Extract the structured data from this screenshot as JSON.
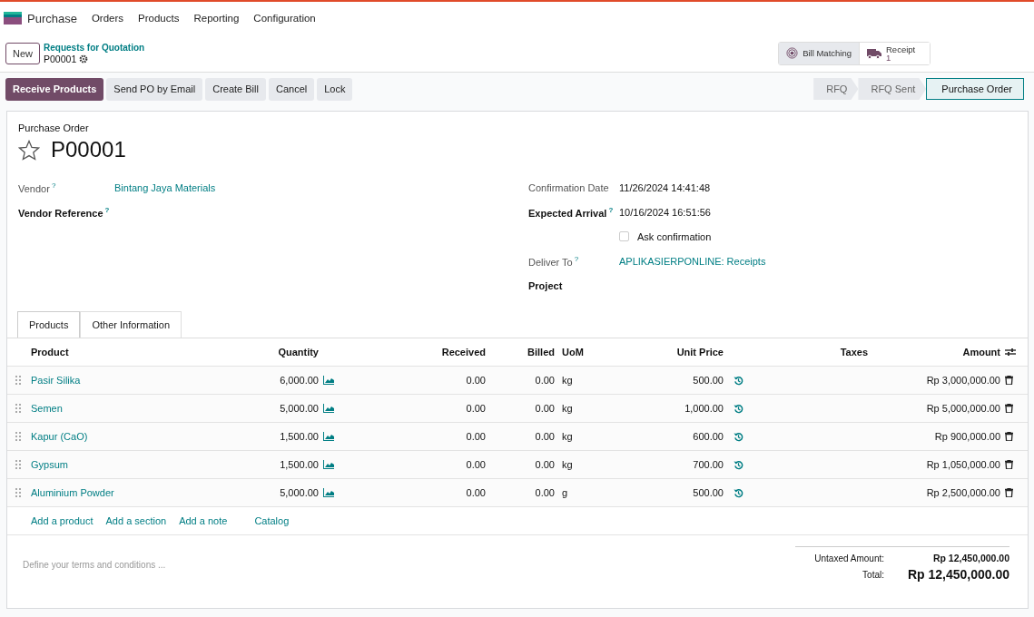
{
  "app": {
    "name": "Purchase",
    "menu": [
      "Orders",
      "Products",
      "Reporting",
      "Configuration"
    ]
  },
  "control_panel": {
    "new_button": "New",
    "breadcrumb": "Requests for Quotation",
    "record": "P00001"
  },
  "smart_buttons": [
    {
      "kind": "bill",
      "label": "Bill Matching"
    },
    {
      "kind": "receipt",
      "label": "Receipt",
      "count": "1"
    }
  ],
  "actions": [
    {
      "label": "Receive Products",
      "primary": true
    },
    {
      "label": "Send PO by Email",
      "primary": false
    },
    {
      "label": "Create Bill",
      "primary": false
    },
    {
      "label": "Cancel",
      "primary": false
    },
    {
      "label": "Lock",
      "primary": false
    }
  ],
  "status_steps": [
    {
      "label": "RFQ",
      "selected": false
    },
    {
      "label": "RFQ Sent",
      "selected": false
    },
    {
      "label": "Purchase Order",
      "selected": true
    }
  ],
  "form": {
    "caption": "Purchase Order",
    "title": "P00001",
    "starred": false,
    "left_fields": [
      {
        "label": "Vendor",
        "help": "?",
        "strong": false,
        "value": "Bintang Jaya Materials",
        "link": true
      },
      {
        "label": "Vendor Reference",
        "help": "?",
        "strong": true
      }
    ],
    "right_fields": [
      {
        "kind": "text",
        "label": "Confirmation Date",
        "strong": false,
        "value": "11/26/2024 14:41:48"
      },
      {
        "kind": "text",
        "label": "Expected Arrival",
        "help": "?",
        "strong": true,
        "value": "10/16/2024 16:51:56"
      },
      {
        "kind": "checkbox",
        "label": "Ask confirmation",
        "checked": false
      },
      {
        "kind": "link",
        "label": "Deliver To",
        "help": "?",
        "strong": false,
        "value": "APLIKASIERPONLINE: Receipts"
      },
      {
        "kind": "text",
        "label": "Project",
        "strong": true
      }
    ]
  },
  "tabs": [
    {
      "label": "Products",
      "selected": true
    },
    {
      "label": "Other Information",
      "selected": false
    }
  ],
  "table": {
    "columns": [
      "Product",
      "Quantity",
      "Received",
      "Billed",
      "UoM",
      "Unit Price",
      "Taxes",
      "Amount"
    ],
    "rows": [
      {
        "product": "Pasir Silika",
        "quantity": "6,000.00",
        "received": "0.00",
        "billed": "0.00",
        "uom": "kg",
        "unit_price": "500.00",
        "amount": "Rp 3,000,000.00"
      },
      {
        "product": "Semen",
        "quantity": "5,000.00",
        "received": "0.00",
        "billed": "0.00",
        "uom": "kg",
        "unit_price": "1,000.00",
        "amount": "Rp 5,000,000.00"
      },
      {
        "product": "Kapur (CaO)",
        "quantity": "1,500.00",
        "received": "0.00",
        "billed": "0.00",
        "uom": "kg",
        "unit_price": "600.00",
        "amount": "Rp 900,000.00"
      },
      {
        "product": "Gypsum",
        "quantity": "1,500.00",
        "received": "0.00",
        "billed": "0.00",
        "uom": "kg",
        "unit_price": "700.00",
        "amount": "Rp 1,050,000.00"
      },
      {
        "product": "Aluminium Powder",
        "quantity": "5,000.00",
        "received": "0.00",
        "billed": "0.00",
        "uom": "g",
        "unit_price": "500.00",
        "amount": "Rp 2,500,000.00"
      }
    ],
    "add_links": [
      "Add a product",
      "Add a section",
      "Add a note",
      "Catalog"
    ]
  },
  "terms": {
    "placeholder": "Define your terms and conditions ..."
  },
  "totals": [
    {
      "label": "Untaxed Amount:",
      "value": "Rp 12,450,000.00",
      "grand": false
    },
    {
      "label": "Total:",
      "value": "Rp 12,450,000.00",
      "grand": true
    }
  ]
}
